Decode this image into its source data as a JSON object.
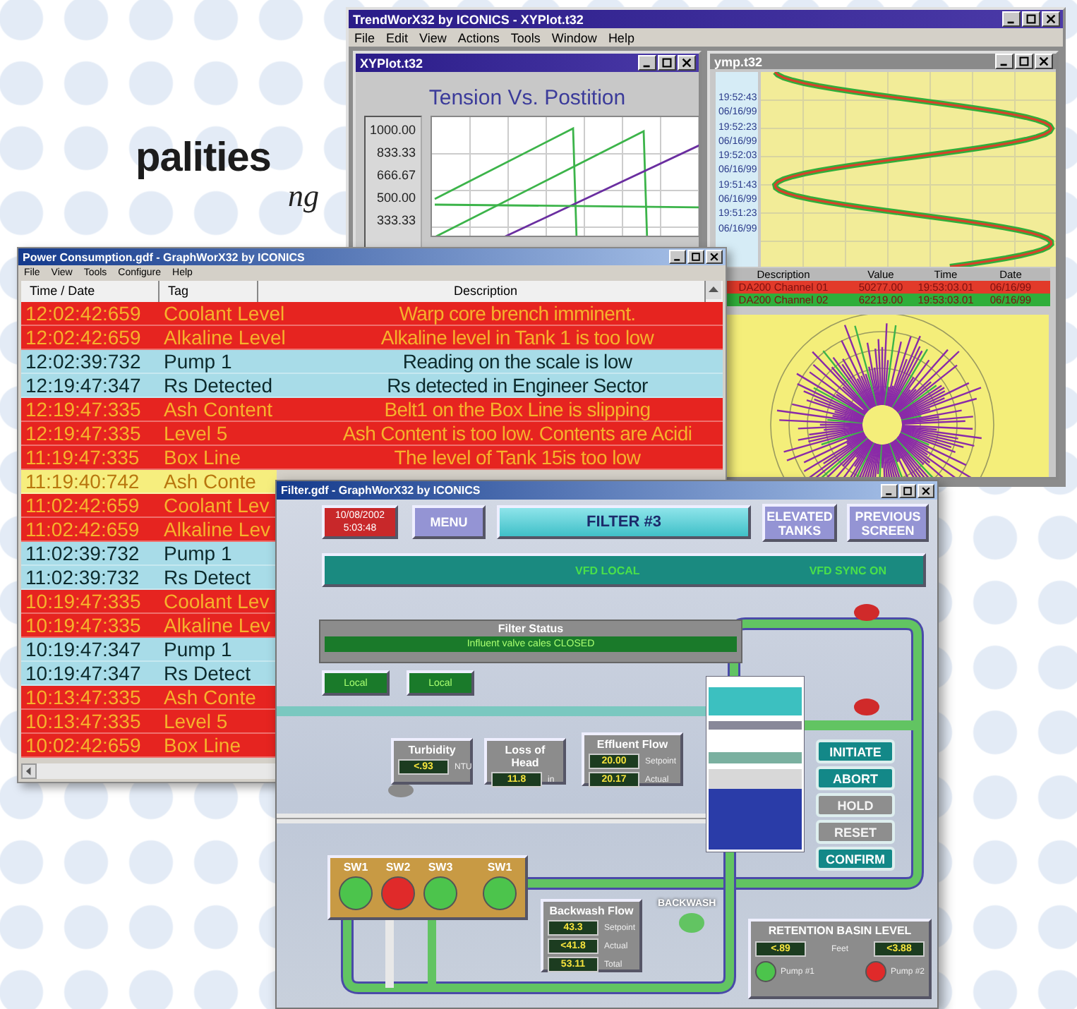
{
  "heading": {
    "title": "palities",
    "subtitle": "ng"
  },
  "trend_window": {
    "title": "TrendWorX32 by ICONICS - XYPlot.t32",
    "menu": [
      "File",
      "Edit",
      "View",
      "Actions",
      "Tools",
      "Window",
      "Help"
    ],
    "xy_plot": {
      "title": "XYPlot.t32",
      "active": true,
      "chart_title": "Tension Vs. Postition",
      "y_labels": [
        "1000.00",
        "833.33",
        "666.67",
        "500.00",
        "333.33"
      ]
    },
    "trend_plot": {
      "title": "ymp.t32",
      "active": false,
      "time_labels": [
        "19:52:43",
        "06/16/99",
        "19:52:23",
        "06/16/99",
        "19:52:03",
        "06/16/99",
        "19:51:43",
        "06/16/99",
        "19:51:23",
        "06/16/99"
      ],
      "legend": {
        "columns": [
          "Description",
          "Value",
          "Time",
          "Date"
        ],
        "rows": [
          {
            "cells": [
              "DA200 Channel 01",
              "50277.00",
              "19:53:03.01",
              "06/16/99"
            ],
            "color": "#e23a2a"
          },
          {
            "cells": [
              "DA200 Channel 02",
              "62219.00",
              "19:53:03.01",
              "06/16/99"
            ],
            "color": "#2fae3a"
          }
        ]
      }
    }
  },
  "power_window": {
    "title": "Power Consumption.gdf - GraphWorX32 by ICONICS",
    "menu": [
      "File",
      "View",
      "Tools",
      "Configure",
      "Help"
    ],
    "columns": [
      "Time / Date",
      "Tag",
      "Description"
    ],
    "rows": [
      {
        "kind": "alarm",
        "time": "12:02:42:659",
        "tag": "Coolant Level",
        "description": "Warp core brench imminent."
      },
      {
        "kind": "alarm",
        "time": "12:02:42:659",
        "tag": "Alkaline Level",
        "description": "Alkaline level in Tank 1 is too low"
      },
      {
        "kind": "normal",
        "time": "12:02:39:732",
        "tag": "Pump 1",
        "description": "Reading on the scale is low"
      },
      {
        "kind": "normal",
        "time": "12:19:47:347",
        "tag": "Rs Detected",
        "description": "Rs detected in Engineer Sector"
      },
      {
        "kind": "alarm",
        "time": "12:19:47:335",
        "tag": "Ash Content",
        "description": "Belt1 on the Box Line is slipping"
      },
      {
        "kind": "alarm",
        "time": "12:19:47:335",
        "tag": "Level 5",
        "description": "Ash Content is too low. Contents are Acidi"
      },
      {
        "kind": "alarm",
        "time": "11:19:47:335",
        "tag": "Box Line",
        "description": "The level of Tank 15is too low"
      },
      {
        "kind": "warning",
        "time": "11:19:40:742",
        "tag": "Ash Conte"
      },
      {
        "kind": "alarm",
        "time": "11:02:42:659",
        "tag": "Coolant Lev"
      },
      {
        "kind": "alarm",
        "time": "11:02:42:659",
        "tag": "Alkaline Lev"
      },
      {
        "kind": "normal",
        "time": "11:02:39:732",
        "tag": "Pump 1"
      },
      {
        "kind": "normal",
        "time": "11:02:39:732",
        "tag": "Rs Detect"
      },
      {
        "kind": "alarm",
        "time": "10:19:47:335",
        "tag": "Coolant Lev"
      },
      {
        "kind": "alarm",
        "time": "10:19:47:335",
        "tag": "Alkaline Lev"
      },
      {
        "kind": "normal",
        "time": "10:19:47:347",
        "tag": "Pump 1"
      },
      {
        "kind": "normal",
        "time": "10:19:47:347",
        "tag": "Rs Detect"
      },
      {
        "kind": "alarm",
        "time": "10:13:47:335",
        "tag": "Ash Conte"
      },
      {
        "kind": "alarm",
        "time": "10:13:47:335",
        "tag": "Level 5"
      },
      {
        "kind": "alarm",
        "time": "10:02:42:659",
        "tag": "Box Line"
      }
    ]
  },
  "filter_window": {
    "title": "Filter.gdf - GraphWorX32 by ICONICS",
    "clock": {
      "date": "10/08/2002",
      "time": "5:03:48"
    },
    "menu_button": "MENU",
    "screen_title": "FILTER #3",
    "nav_buttons": [
      "ELEVATED TANKS",
      "PREVIOUS SCREEN"
    ],
    "vfd_status": [
      "VFD LOCAL",
      "VFD SYNC ON"
    ],
    "filter_status": {
      "title": "Filter Status",
      "message": "Influent valve cales CLOSED"
    },
    "local_buttons": [
      "Local",
      "Local"
    ],
    "readouts": [
      {
        "title": "Turbidity",
        "values": [
          {
            "value": "<.93",
            "unit": "NTU"
          }
        ]
      },
      {
        "title": "Loss of Head",
        "values": [
          {
            "value": "11.8",
            "unit": "in"
          }
        ]
      },
      {
        "title": "Effluent Flow",
        "values": [
          {
            "value": "20.00",
            "unit": "Setpoint"
          },
          {
            "value": "20.17",
            "unit": "Actual"
          }
        ]
      }
    ],
    "sequence_buttons": [
      {
        "label": "INITIATE",
        "disabled": false
      },
      {
        "label": "ABORT",
        "disabled": false
      },
      {
        "label": "HOLD",
        "disabled": true
      },
      {
        "label": "RESET",
        "disabled": true
      },
      {
        "label": "CONFIRM",
        "disabled": false
      }
    ],
    "switches": [
      {
        "label": "SW1",
        "on": true
      },
      {
        "label": "SW2",
        "on": false
      },
      {
        "label": "SW3",
        "on": true
      },
      {
        "label": "SW1",
        "on": true
      }
    ],
    "backwash_flow": {
      "title": "Backwash Flow",
      "values": [
        {
          "value": "43.3",
          "unit": "Setpoint"
        },
        {
          "value": "<41.8",
          "unit": "Actual"
        },
        {
          "value": "53.11",
          "unit": "Total"
        }
      ]
    },
    "backwash_label": "BACKWASH",
    "retention_basin": {
      "title": "RETENTION BASIN LEVEL",
      "values": [
        "<.89",
        "<3.88"
      ],
      "unit": "Feet",
      "pumps": [
        {
          "label": "Pump #1",
          "on": true
        },
        {
          "label": "Pump #2",
          "on": false
        }
      ]
    }
  }
}
